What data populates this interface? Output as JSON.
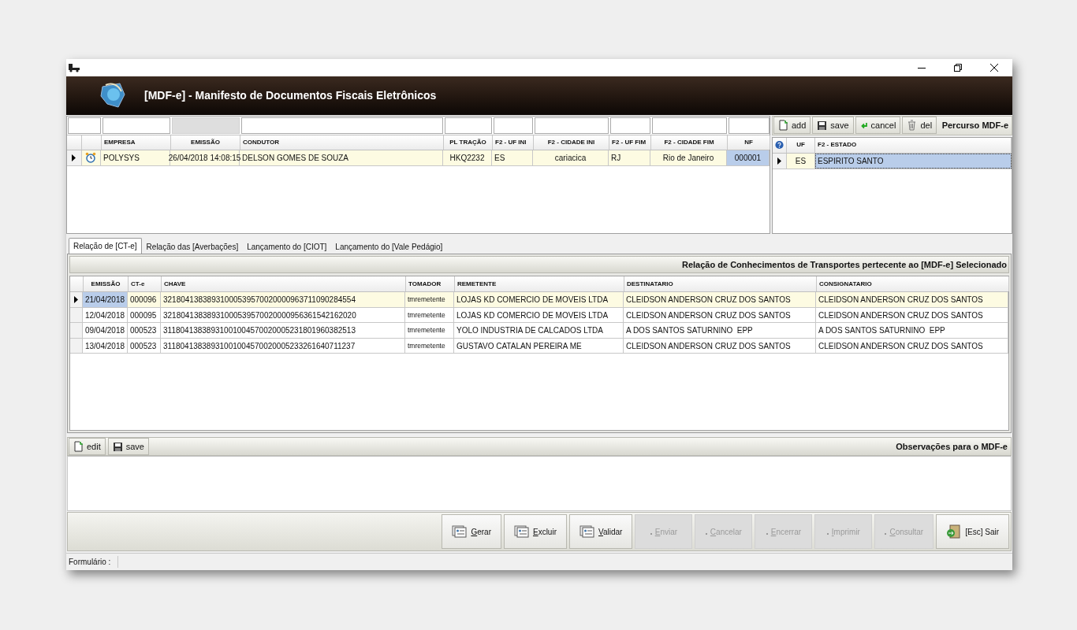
{
  "window": {
    "title": "[MDF-e] - Manifesto de Documentos Fiscais Eletrônicos"
  },
  "manifest_grid": {
    "filters": [
      {
        "disabled": false
      },
      {
        "disabled": false
      },
      {
        "disabled": true
      },
      {
        "disabled": false
      },
      {
        "disabled": false
      },
      {
        "disabled": false
      },
      {
        "disabled": false
      },
      {
        "disabled": false
      },
      {
        "disabled": false
      },
      {
        "disabled": false
      }
    ],
    "columns": [
      "EMPRESA",
      "EMISSÃO",
      "CONDUTOR",
      "PL TRAÇÃO",
      "F2 - UF INI",
      "F2 - CIDADE INI",
      "F2 - UF FIM",
      "F2 - CIDADE FIM",
      "NF"
    ],
    "rows": [
      {
        "selected": true,
        "cells": [
          {
            "text": "POLYSYS",
            "focused": false
          },
          {
            "text": "26/04/2018 14:08:15",
            "focused": false
          },
          {
            "text": "DELSON GOMES DE SOUZA",
            "focused": false
          },
          {
            "text": "HKQ2232",
            "focused": false
          },
          {
            "text": "ES",
            "focused": false
          },
          {
            "text": "cariacica",
            "focused": false
          },
          {
            "text": "RJ",
            "focused": false
          },
          {
            "text": "Rio de Janeiro",
            "focused": false
          },
          {
            "text": "000001",
            "focused": true
          }
        ]
      }
    ]
  },
  "route_panel": {
    "title": "Percurso MDF-e",
    "buttons": [
      {
        "kind": "add",
        "label": "add"
      },
      {
        "kind": "save",
        "label": "save"
      },
      {
        "kind": "cancel",
        "label": "cancel"
      },
      {
        "kind": "del",
        "label": "del"
      }
    ],
    "columns": [
      "UF",
      "F2 - ESTADO"
    ],
    "rows": [
      {
        "selected": true,
        "cells": [
          {
            "text": "ES",
            "focused": false
          },
          {
            "text": "ESPIRITO SANTO",
            "focused": true
          }
        ]
      }
    ]
  },
  "tabs": [
    {
      "label": "Relação de [CT-e]",
      "selected": true
    },
    {
      "label": "Relação das [Averbações]",
      "selected": false
    },
    {
      "label": "Lançamento do [CIOT]",
      "selected": false
    },
    {
      "label": "Lançamento do [Vale Pedágio]",
      "selected": false
    }
  ],
  "cte_panel": {
    "title": "Relação de Conhecimentos de Transportes pertecente ao [MDF-e] Selecionado",
    "columns": [
      "EMISSÃO",
      "CT-e",
      "CHAVE",
      "TOMADOR",
      "REMETENTE",
      "DESTINATARIO",
      "CONSIGNATARIO"
    ],
    "rows": [
      {
        "selected": true,
        "cells": [
          {
            "text": "21/04/2018",
            "focused": true
          },
          {
            "text": "000096",
            "focused": false
          },
          {
            "text": "32180413838931000539570020000963711090284554",
            "focused": false
          },
          {
            "text": "tmremetente",
            "focused": false
          },
          {
            "text": "LOJAS KD COMERCIO DE MOVEIS LTDA",
            "focused": false
          },
          {
            "text": "CLEIDSON ANDERSON CRUZ DOS SANTOS",
            "focused": false
          },
          {
            "text": "CLEIDSON ANDERSON CRUZ DOS SANTOS",
            "focused": false
          }
        ]
      },
      {
        "selected": false,
        "cells": [
          {
            "text": "12/04/2018",
            "focused": false
          },
          {
            "text": "000095",
            "focused": false
          },
          {
            "text": "32180413838931000539570020000956361542162020",
            "focused": false
          },
          {
            "text": "tmremetente",
            "focused": false
          },
          {
            "text": "LOJAS KD COMERCIO DE MOVEIS LTDA",
            "focused": false
          },
          {
            "text": "CLEIDSON ANDERSON CRUZ DOS SANTOS",
            "focused": false
          },
          {
            "text": "CLEIDSON ANDERSON CRUZ DOS SANTOS",
            "focused": false
          }
        ]
      },
      {
        "selected": false,
        "cells": [
          {
            "text": "09/04/2018",
            "focused": false
          },
          {
            "text": "000523",
            "focused": false
          },
          {
            "text": "31180413838931001004570020005231801960382513",
            "focused": false
          },
          {
            "text": "tmremetente",
            "focused": false
          },
          {
            "text": "YOLO INDUSTRIA DE CALCADOS LTDA",
            "focused": false
          },
          {
            "text": "A DOS SANTOS SATURNINO  EPP",
            "focused": false
          },
          {
            "text": "A DOS SANTOS SATURNINO  EPP",
            "focused": false
          }
        ]
      },
      {
        "selected": false,
        "cells": [
          {
            "text": "13/04/2018",
            "focused": false
          },
          {
            "text": "000523",
            "focused": false
          },
          {
            "text": "31180413838931001004570020005233261640711237",
            "focused": false
          },
          {
            "text": "tmremetente",
            "focused": false
          },
          {
            "text": "GUSTAVO CATALAN PEREIRA ME",
            "focused": false
          },
          {
            "text": "CLEIDSON ANDERSON CRUZ DOS SANTOS",
            "focused": false
          },
          {
            "text": "CLEIDSON ANDERSON CRUZ DOS SANTOS",
            "focused": false
          }
        ]
      }
    ]
  },
  "observations": {
    "title": "Observações para o MDF-e",
    "buttons": [
      {
        "kind": "edit",
        "label": "edit"
      },
      {
        "kind": "save",
        "label": "save"
      }
    ]
  },
  "actions": [
    {
      "label": "Gerar",
      "kind": "form",
      "disabled": false,
      "mnemonic": true
    },
    {
      "label": "Excluir",
      "kind": "form",
      "disabled": false,
      "mnemonic": true
    },
    {
      "label": "Validar",
      "kind": "form",
      "disabled": false,
      "mnemonic": true
    },
    {
      "label": "Enviar",
      "kind": "form",
      "disabled": true,
      "mnemonic": true
    },
    {
      "label": "Cancelar",
      "kind": "form",
      "disabled": true,
      "mnemonic": true
    },
    {
      "label": "Encerrar",
      "kind": "form",
      "disabled": true,
      "mnemonic": true
    },
    {
      "label": "Imprimir",
      "kind": "form",
      "disabled": true,
      "mnemonic": true
    },
    {
      "label": "Consultar",
      "kind": "form",
      "disabled": true,
      "mnemonic": true
    },
    {
      "label": "[Esc] Sair",
      "kind": "exit",
      "disabled": false,
      "mnemonic": false
    }
  ],
  "status_bar": {
    "label": "Formulário :"
  }
}
